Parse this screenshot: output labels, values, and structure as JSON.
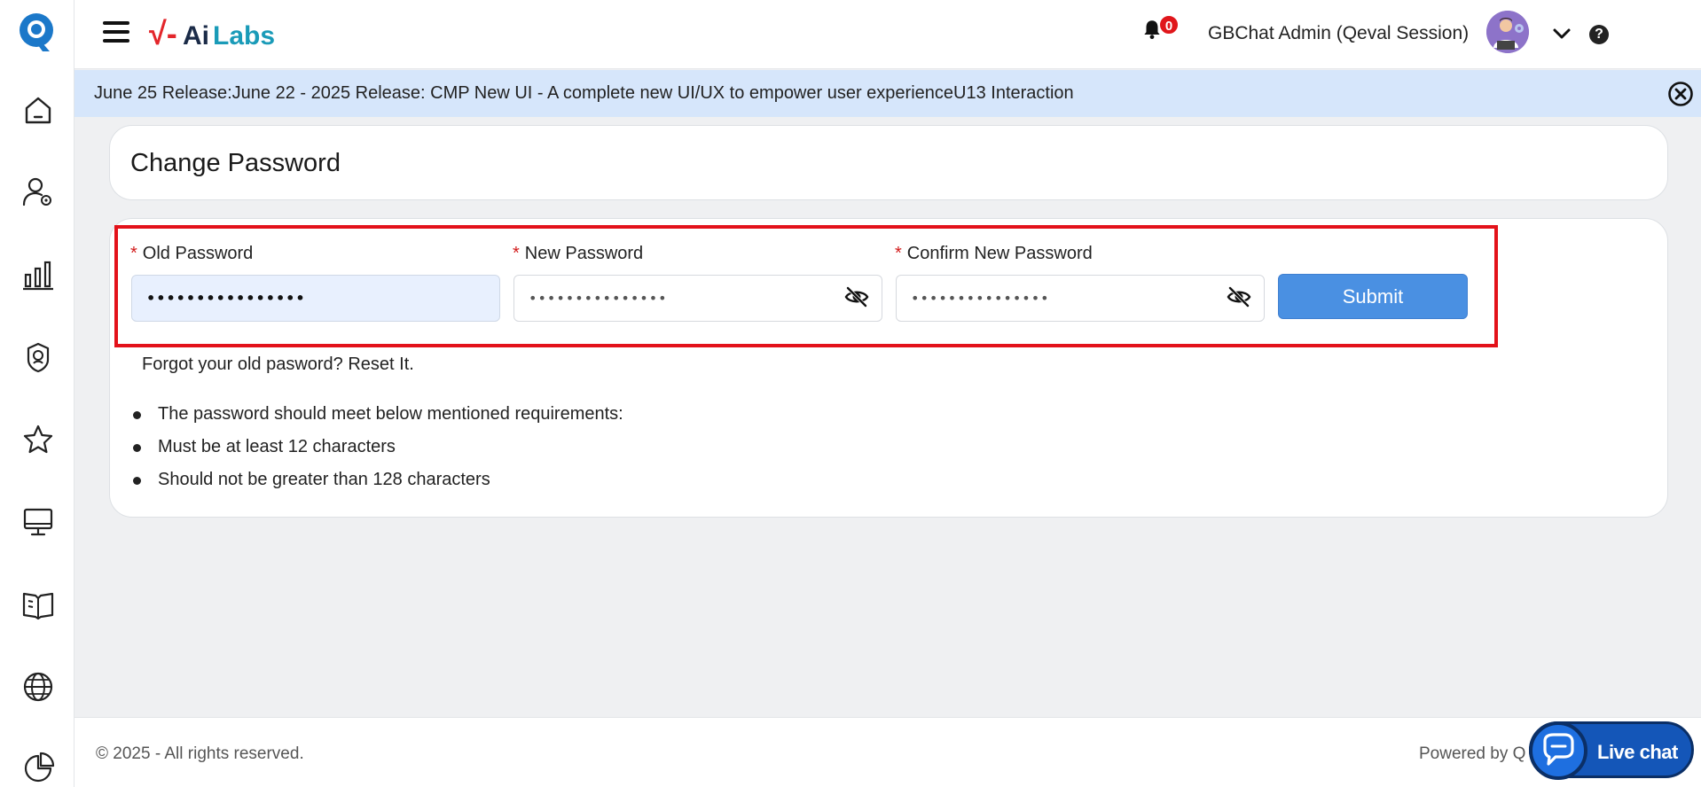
{
  "sidebar": {
    "logo": "q-logo",
    "items": [
      {
        "icon": "home-icon"
      },
      {
        "icon": "user-settings-icon"
      },
      {
        "icon": "bar-chart-icon"
      },
      {
        "icon": "badge-icon"
      },
      {
        "icon": "star-icon"
      },
      {
        "icon": "monitor-icon"
      },
      {
        "icon": "book-icon"
      },
      {
        "icon": "globe-icon"
      },
      {
        "icon": "pie-chart-icon"
      }
    ]
  },
  "header": {
    "brand_prefix": "√-",
    "brand_ai": "Ai",
    "brand_labs": "Labs",
    "notification_count": "0",
    "user_name": "GBChat Admin (Qeval Session)",
    "help_symbol": "?"
  },
  "banner": {
    "text": "June 25 Release:June 22 - 2025 Release: CMP New UI - A complete new UI/UX to empower user experienceU13 Interaction"
  },
  "page": {
    "title": "Change Password"
  },
  "form": {
    "required_marker": "*",
    "old_password": {
      "label": "Old Password",
      "value": "••••••••••••••••"
    },
    "new_password": {
      "label": "New Password",
      "value": "•••••••••••••••"
    },
    "confirm_password": {
      "label": "Confirm New Password",
      "value": "•••••••••••••••"
    },
    "submit_label": "Submit",
    "forgot_text": "Forgot your old pasword? ",
    "reset_link": "Reset It."
  },
  "requirements": [
    "The password should meet below mentioned requirements:",
    "Must be at least 12 characters",
    "Should not be greater than 128 characters"
  ],
  "footer": {
    "copyright": "© 2025 - All rights reserved.",
    "powered_by": "Powered by Q"
  },
  "live_chat": {
    "label": "Live chat"
  },
  "colors": {
    "accent": "#4a90e2",
    "banner_bg": "#d6e6fb",
    "highlight_border": "#e3121a",
    "required": "#d21b1b",
    "notification_badge": "#e0161b"
  }
}
